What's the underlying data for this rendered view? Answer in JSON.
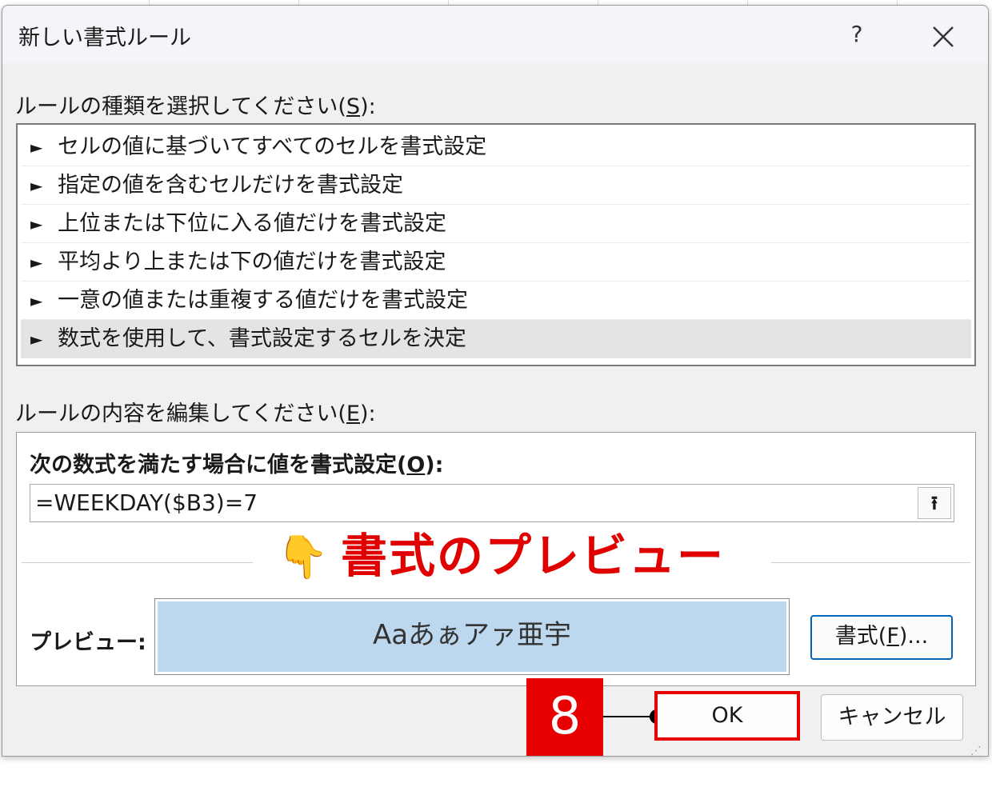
{
  "dialog": {
    "title": "新しい書式ルール",
    "help_label": "?",
    "close_label": "✕"
  },
  "rule_type": {
    "label_before": "ルールの種類を選択してください(",
    "label_key": "S",
    "label_after": "):",
    "items": [
      {
        "label": "セルの値に基づいてすべてのセルを書式設定"
      },
      {
        "label": "指定の値を含むセルだけを書式設定"
      },
      {
        "label": "上位または下位に入る値だけを書式設定"
      },
      {
        "label": "平均より上または下の値だけを書式設定"
      },
      {
        "label": "一意の値または重複する値だけを書式設定"
      },
      {
        "label": "数式を使用して、書式設定するセルを決定"
      }
    ],
    "selected_index": 5,
    "arrow_glyph": "►"
  },
  "rule_edit": {
    "label_before": "ルールの内容を編集してください(",
    "label_key": "E",
    "label_after": "):",
    "formula_label_before": "次の数式を満たす場合に値を書式設定(",
    "formula_label_key": "O",
    "formula_label_after": "):",
    "formula_value": "=WEEKDAY($B3)=7",
    "collapse_glyph": "⭱",
    "preview_label": "プレビュー:",
    "preview_sample": "Aaあぁアァ亜宇",
    "preview_fill_color": "#bdd7ee",
    "format_button_before": "書式(",
    "format_button_key": "F",
    "format_button_after": ")..."
  },
  "buttons": {
    "ok": "OK",
    "cancel": "キャンセル"
  },
  "annotation": {
    "icon": "👇",
    "text": "書式のプレビュー",
    "step_number": "8",
    "color": "#e00000"
  }
}
